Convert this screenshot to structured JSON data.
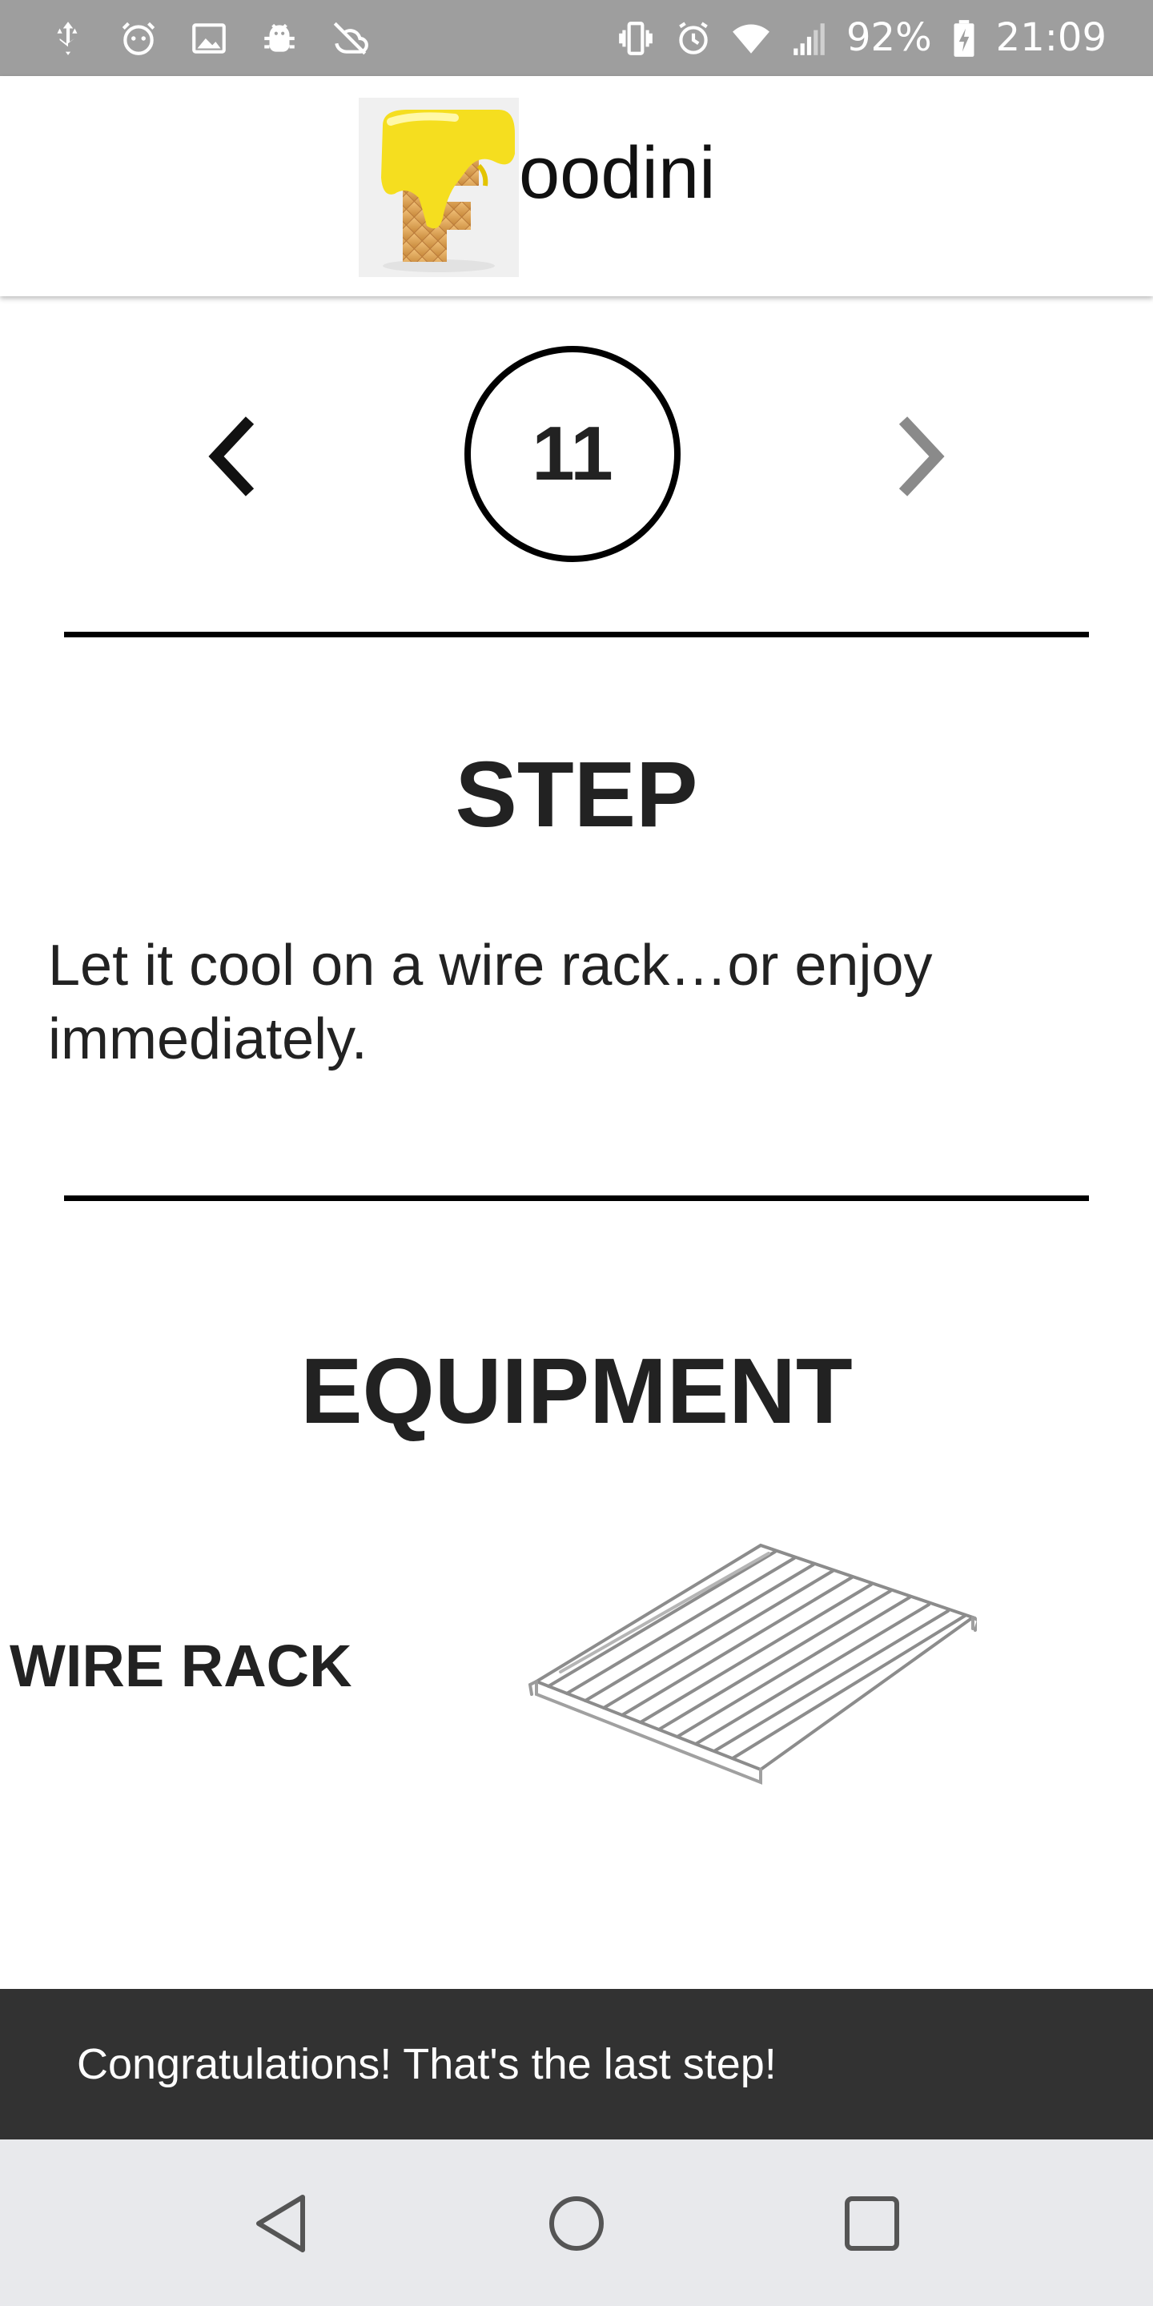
{
  "status_bar": {
    "battery_percent": "92%",
    "time": "21:09",
    "left_icons": [
      "usb-icon",
      "alarm-face-icon",
      "image-icon",
      "android-debug-icon",
      "sync-off-icon"
    ],
    "right_icons": [
      "vibrate-icon",
      "alarm-clock-icon",
      "wifi-icon",
      "signal-icon",
      "battery-charging-icon"
    ]
  },
  "app_bar": {
    "logo_icon": "foodini-logo",
    "brand_suffix": "oodini"
  },
  "step_nav": {
    "current_step": "11",
    "prev_icon": "chevron-left-icon",
    "next_icon": "chevron-right-icon",
    "prev_color": "#111111",
    "next_color": "#8a8a8a"
  },
  "step_section": {
    "heading": "STEP",
    "text": "Let it cool on a wire rack…or enjoy immediately."
  },
  "equipment_section": {
    "heading": "EQUIPMENT",
    "items": [
      {
        "name": "WIRE RACK",
        "icon": "wire-rack-image"
      }
    ]
  },
  "snackbar": {
    "message": "Congratulations! That's the last step!"
  },
  "nav_bar": {
    "icons": [
      "back-triangle-icon",
      "home-circle-icon",
      "recents-square-icon"
    ]
  }
}
